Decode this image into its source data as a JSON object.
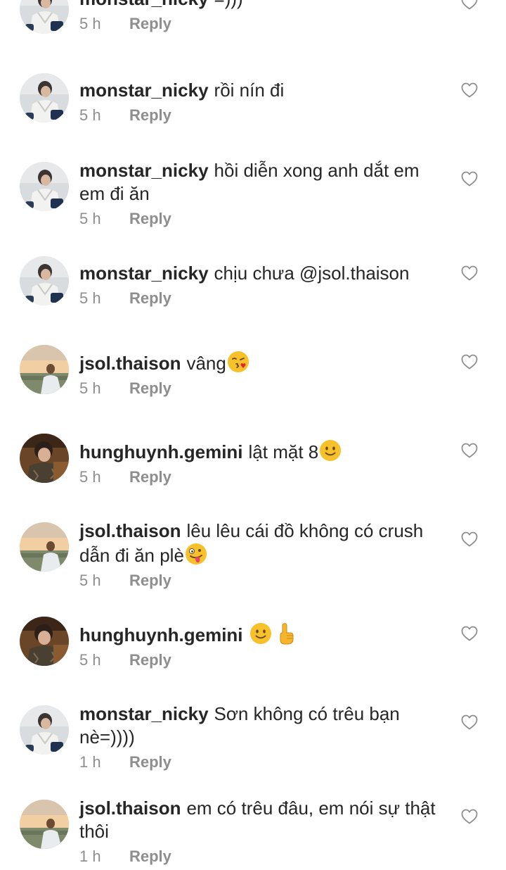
{
  "comments": [
    {
      "username": "monstar_nicky",
      "text": "=)))",
      "time": "5 h",
      "reply": "Reply",
      "avatar": "avatar-nicky",
      "emojis": []
    },
    {
      "username": "monstar_nicky",
      "text": "rồi nín đi",
      "time": "5 h",
      "reply": "Reply",
      "avatar": "avatar-nicky",
      "emojis": []
    },
    {
      "username": "monstar_nicky",
      "text": "hồi diễn xong anh dắt em em đi ăn",
      "time": "5 h",
      "reply": "Reply",
      "avatar": "avatar-nicky",
      "emojis": []
    },
    {
      "username": "monstar_nicky",
      "text": "chịu chưa @jsol.thaison",
      "time": "5 h",
      "reply": "Reply",
      "avatar": "avatar-nicky",
      "emojis": []
    },
    {
      "username": "jsol.thaison",
      "text": "vâng",
      "time": "5 h",
      "reply": "Reply",
      "avatar": "avatar-thaison",
      "emojis": [
        "face-blowing-kiss-emoji"
      ]
    },
    {
      "username": "hunghuynh.gemini",
      "text": "lật mặt 8",
      "time": "5 h",
      "reply": "Reply",
      "avatar": "avatar-hunghuynh",
      "emojis": [
        "slightly-smiling-face-emoji"
      ]
    },
    {
      "username": "jsol.thaison",
      "text": "lêu lêu cái đồ không có crush dẫn đi ăn plè",
      "time": "5 h",
      "reply": "Reply",
      "avatar": "avatar-thaison",
      "emojis": [
        "zany-face-emoji"
      ]
    },
    {
      "username": "hunghuynh.gemini",
      "text": "",
      "time": "5 h",
      "reply": "Reply",
      "avatar": "avatar-hunghuynh",
      "emojis": [
        "slightly-smiling-face-emoji",
        "pointing-up-emoji"
      ]
    },
    {
      "username": "monstar_nicky",
      "text": "Sơn không có trêu bạn nè=))))",
      "time": "1 h",
      "reply": "Reply",
      "avatar": "avatar-nicky",
      "emojis": []
    },
    {
      "username": "jsol.thaison",
      "text": "em có trêu đâu, em nói sự thật thôi",
      "time": "1 h",
      "reply": "Reply",
      "avatar": "avatar-thaison",
      "emojis": []
    }
  ],
  "like_icon": "heart-outline-icon"
}
